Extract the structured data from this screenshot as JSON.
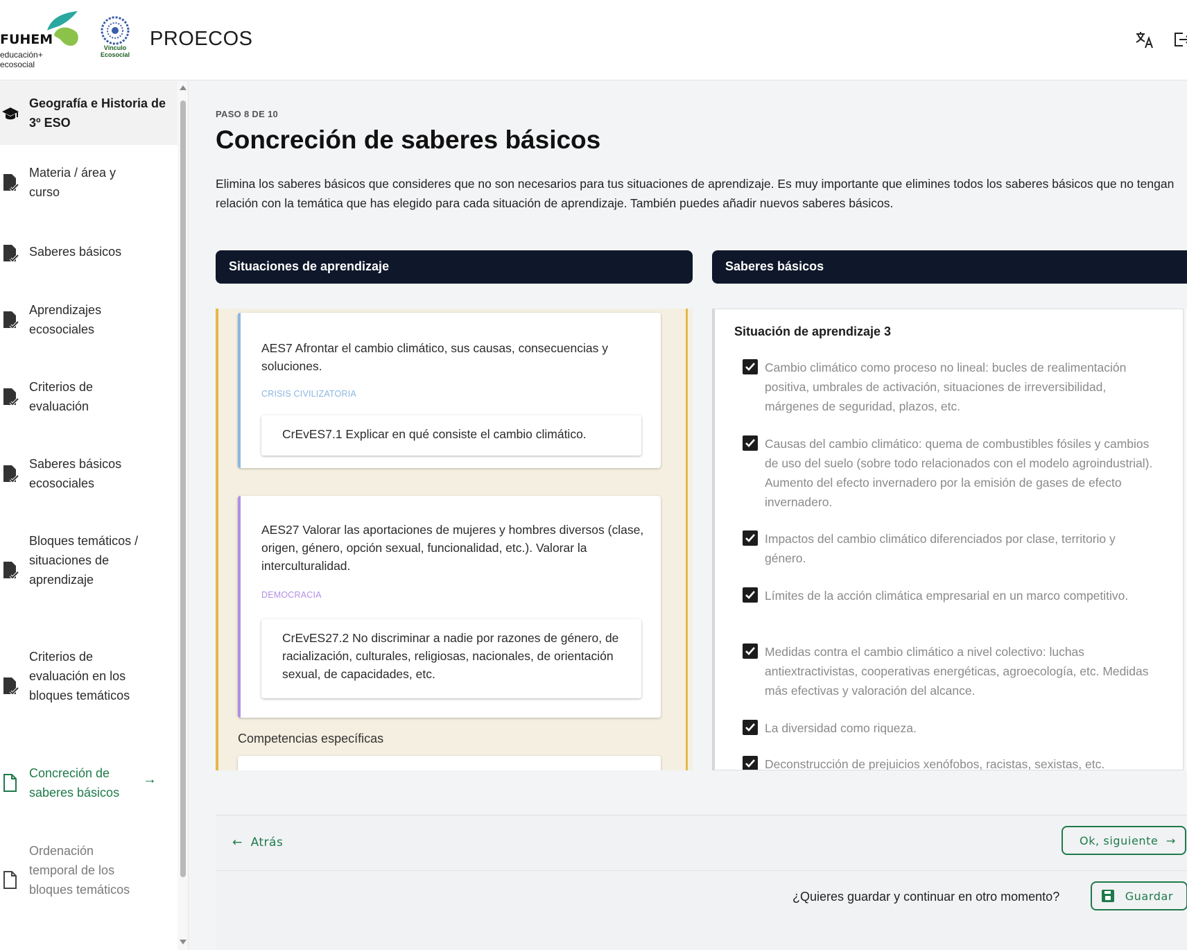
{
  "header": {
    "brand": "FUHEM",
    "brand_tag_line1": "educación+",
    "brand_tag_line2": "ecosocial",
    "partner_logo_text": "Vínculo Ecosocial",
    "app_title": "PROECOS",
    "translate_icon": "translate-icon",
    "logout_icon": "logout-icon"
  },
  "sidebar": {
    "course_title": "Geografía e Historia de 3º ESO",
    "items": [
      {
        "label": "Materia / área y curso",
        "state": "done"
      },
      {
        "label": "Saberes básicos",
        "state": "done"
      },
      {
        "label": "Aprendizajes ecosociales",
        "state": "done"
      },
      {
        "label": "Criterios de evaluación",
        "state": "done"
      },
      {
        "label": "Saberes básicos ecosociales",
        "state": "done"
      },
      {
        "label": "Bloques temáticos / situaciones de aprendizaje",
        "state": "done"
      },
      {
        "label": "Criterios de evaluación en los bloques temáticos",
        "state": "done"
      },
      {
        "label": "Concreción de saberes básicos",
        "state": "active"
      },
      {
        "label": "Ordenación temporal de los bloques temáticos",
        "state": "pending"
      }
    ]
  },
  "main": {
    "step": "PASO 8 DE 10",
    "title": "Concreción de saberes básicos",
    "description": "Elimina los saberes básicos que consideres que no son necesarios para tus situaciones de aprendizaje. Es muy importante que elimines todos los saberes básicos que no tengan relación con la temática que has elegido para cada situación de aprendizaje. También puedes añadir nuevos saberes básicos.",
    "left_header": "Situaciones de aprendizaje",
    "right_header": "Saberes básicos",
    "cards": [
      {
        "text": "AES7 Afrontar el cambio climático, sus causas, consecuencias y soluciones.",
        "tag": "CRISIS CIVILIZATORIA",
        "criterion": "CrEvES7.1 Explicar en qué consiste el cambio climático."
      },
      {
        "text": "AES27 Valorar las aportaciones de mujeres y hombres diversos (clase, origen, género, opción sexual, funcionalidad, etc.). Valorar la interculturalidad.",
        "tag": "DEMOCRACIA",
        "criterion": "CrEvES27.2 No discriminar a nadie por razones de género, de racialización, culturales, religiosas, nacionales, de orientación sexual, de capacidades, etc."
      }
    ],
    "competencias_label": "Competencias específicas",
    "situation_title": "Situación de aprendizaje 3",
    "saberes": [
      {
        "text": "Cambio climático como proceso no lineal: bucles de realimentación positiva, umbrales de activación, situaciones de irreversibilidad, márgenes de seguridad, plazos, etc.",
        "checked": true
      },
      {
        "text": "Causas del cambio climático: quema de combustibles fósiles y cambios de uso del suelo (sobre todo relacionados con el modelo agroindustrial). Aumento del efecto invernadero por la emisión de gases de efecto invernadero.",
        "checked": true
      },
      {
        "text": "Impactos del cambio climático diferenciados por clase, territorio y género.",
        "checked": true
      },
      {
        "text": "Límites de la acción climática empresarial en un marco competitivo.",
        "checked": true
      },
      {
        "text": "Medidas contra el cambio climático a nivel colectivo: luchas antiextractivistas, cooperativas energéticas, agroecología, etc. Medidas más efectivas y valoración del alcance.",
        "checked": true
      },
      {
        "text": "La diversidad como riqueza.",
        "checked": true
      },
      {
        "text": "Deconstrucción de prejuicios xenófobos, racistas, sexistas, etc.",
        "checked": true
      }
    ],
    "back_label": "Atrás",
    "next_label": "Ok, siguiente",
    "save_question": "¿Quieres guardar y continuar en otro momento?",
    "save_label": "Guardar"
  },
  "colors": {
    "accent_green": "#1e7a4a",
    "dark_header": "#0f172a",
    "panel_yellow": "#e4b949",
    "tag_blue": "#8ab6e0",
    "tag_purple": "#b18ee6"
  }
}
